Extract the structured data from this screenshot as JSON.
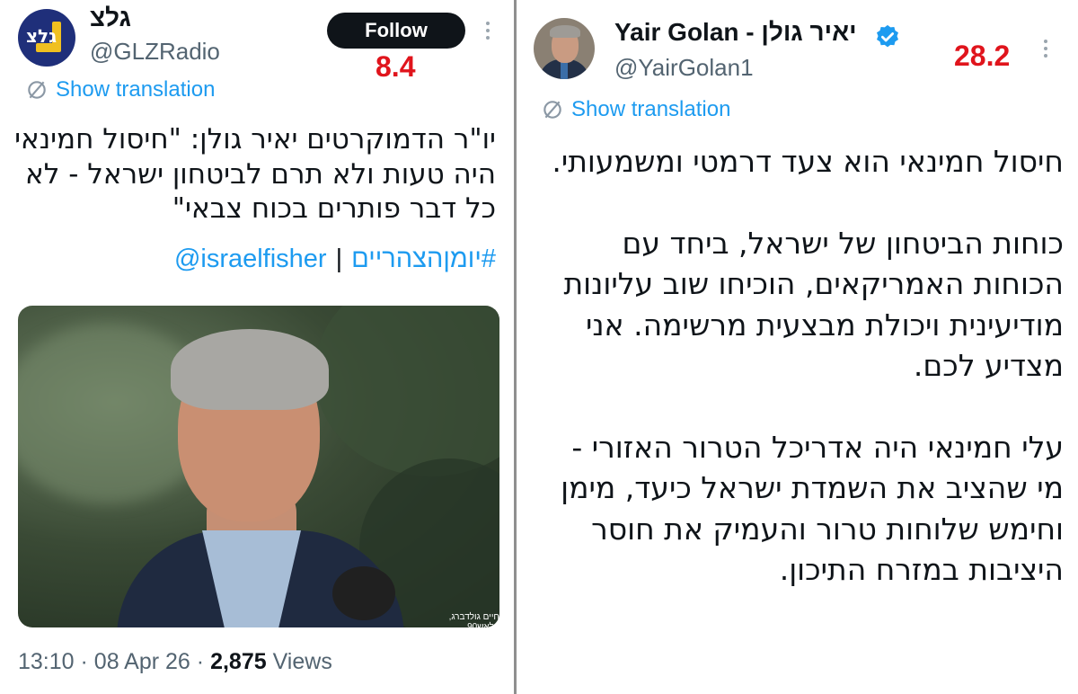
{
  "left_tweet": {
    "logo_text": "גלצ",
    "display_name": "גלצ",
    "handle": "@GLZRadio",
    "follow_label": "Follow",
    "overlay_number": "8.4",
    "show_translation": "Show translation",
    "text": "יו\"ר הדמוקרטים יאיר גולן: \"חיסול חמינאי\nהיה טעות ולא תרם לביטחון ישראל - לא\nכל דבר פותרים בכוח צבאי\"",
    "hashtag": "#יומןהצהריים",
    "separator": "|",
    "mention": "@israelfisher",
    "photo_credit": "חיים גולדברג, פלאש90",
    "time": "13:10",
    "date": "08 Apr 26",
    "views_count": "2,875",
    "views_label": "Views"
  },
  "right_tweet": {
    "display_name": "Yair Golan - יאיר גולן",
    "handle": "@YairGolan1",
    "overlay_number": "28.2",
    "show_translation": "Show translation",
    "text": "חיסול חמינאי הוא צעד דרמטי ומשמעותי.\n\nכוחות הביטחון של ישראל, ביחד עם\nהכוחות האמריקאים, הוכיחו שוב עליונות\nמודיעינית ויכולת מבצעית מרשימה. אני\nמצדיע לכם.\n\nעלי חמינאי היה אדריכל הטרור האזורי -\nמי שהציב את השמדת ישראל כיעד, מימן\nוחימש שלוחות טרור והעמיק את חוסר\nהיציבות במזרח התיכון."
  },
  "colors": {
    "link": "#1d9bf0",
    "overlay_red": "#e0141c",
    "follow_bg": "#0f1419",
    "verified": "#1d9bf0"
  },
  "icons": [
    "translate-icon",
    "more-options-icon",
    "verified-badge-icon"
  ]
}
